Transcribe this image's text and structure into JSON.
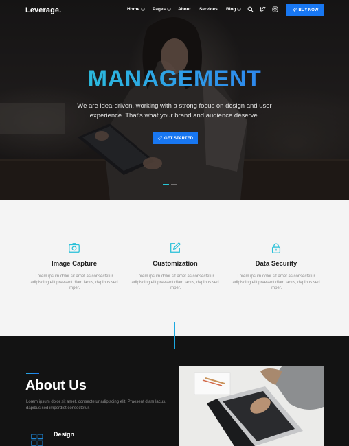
{
  "nav": {
    "logo": "Leverage.",
    "items": [
      {
        "label": "Home",
        "has_caret": true
      },
      {
        "label": "Pages",
        "has_caret": true
      },
      {
        "label": "About",
        "has_caret": false
      },
      {
        "label": "Services",
        "has_caret": false
      },
      {
        "label": "Blog",
        "has_caret": true
      }
    ],
    "icons": [
      "search-icon",
      "twitter-icon",
      "instagram-icon"
    ],
    "buy_label": "BUY NOW"
  },
  "hero": {
    "title": "MANAGEMENT",
    "subtitle": "We are idea-driven, working with a strong focus on design and user experience. That's what your brand and audience deserve.",
    "cta_label": "GET STARTED",
    "slides": 2,
    "active_slide": 0
  },
  "features": [
    {
      "icon": "camera-icon",
      "title": "Image Capture",
      "desc": "Lorem ipsum dolor sit amet as consectetur adipiscing elit praesent diam lacus, dapibus sed imper."
    },
    {
      "icon": "edit-icon",
      "title": "Customization",
      "desc": "Lorem ipsum dolor sit amet as consectetur adipiscing elit praesent diam lacus, dapibus sed imper."
    },
    {
      "icon": "lock-icon",
      "title": "Data Security",
      "desc": "Lorem ipsum dolor sit amet as consectetur adipiscing elit praesent diam lacus, dapibus sed imper."
    }
  ],
  "about": {
    "title": "About Us",
    "text": "Lorem ipsum dolor sit amet, consectetur adipiscing elit. Praesent diam lacus, dapibus sed imperdiet consectetur.",
    "items": [
      {
        "icon": "grid-icon",
        "title": "Design"
      }
    ]
  },
  "colors": {
    "accent": "#1877f2",
    "cyan": "#27c7d6",
    "dark_bg": "#131313",
    "light_bg": "#f4f4f4"
  }
}
